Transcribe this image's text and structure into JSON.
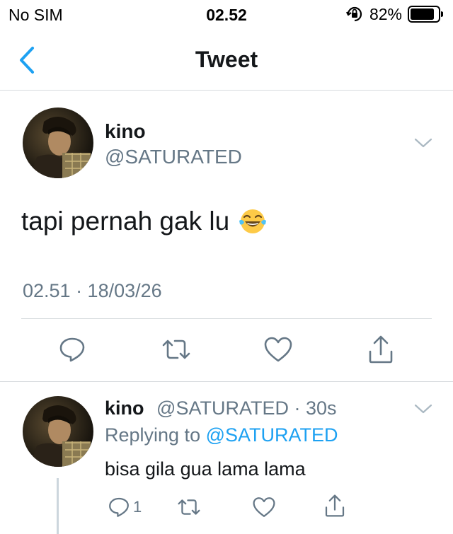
{
  "status_bar": {
    "carrier": "No SIM",
    "time": "02.52",
    "battery_percent": "82%",
    "icons": [
      "orientation-lock-icon",
      "battery-icon"
    ]
  },
  "nav": {
    "title": "Tweet",
    "back_icon": "chevron-left-icon"
  },
  "colors": {
    "accent": "#1da1f2",
    "text_primary": "#14171a",
    "text_secondary": "#657786",
    "divider": "#d7dbde",
    "icon_gray": "#657786"
  },
  "main_tweet": {
    "name": "kino",
    "handle": "@SATURATED",
    "text": "tapi pernah gak lu",
    "emoji": "face-with-tears-of-joy-icon",
    "timestamp": "02.51 · 18/03/26",
    "actions": [
      "reply-icon",
      "retweet-icon",
      "like-icon",
      "share-icon"
    ]
  },
  "reply_tweet": {
    "name": "kino",
    "handle": "@SATURATED",
    "time": " · 30s",
    "replying_prefix": "Replying to ",
    "replying_to": "@SATURATED",
    "text": "bisa gila gua lama lama",
    "reply_count": "1",
    "actions": [
      "reply-icon",
      "retweet-icon",
      "like-icon",
      "share-icon"
    ]
  }
}
